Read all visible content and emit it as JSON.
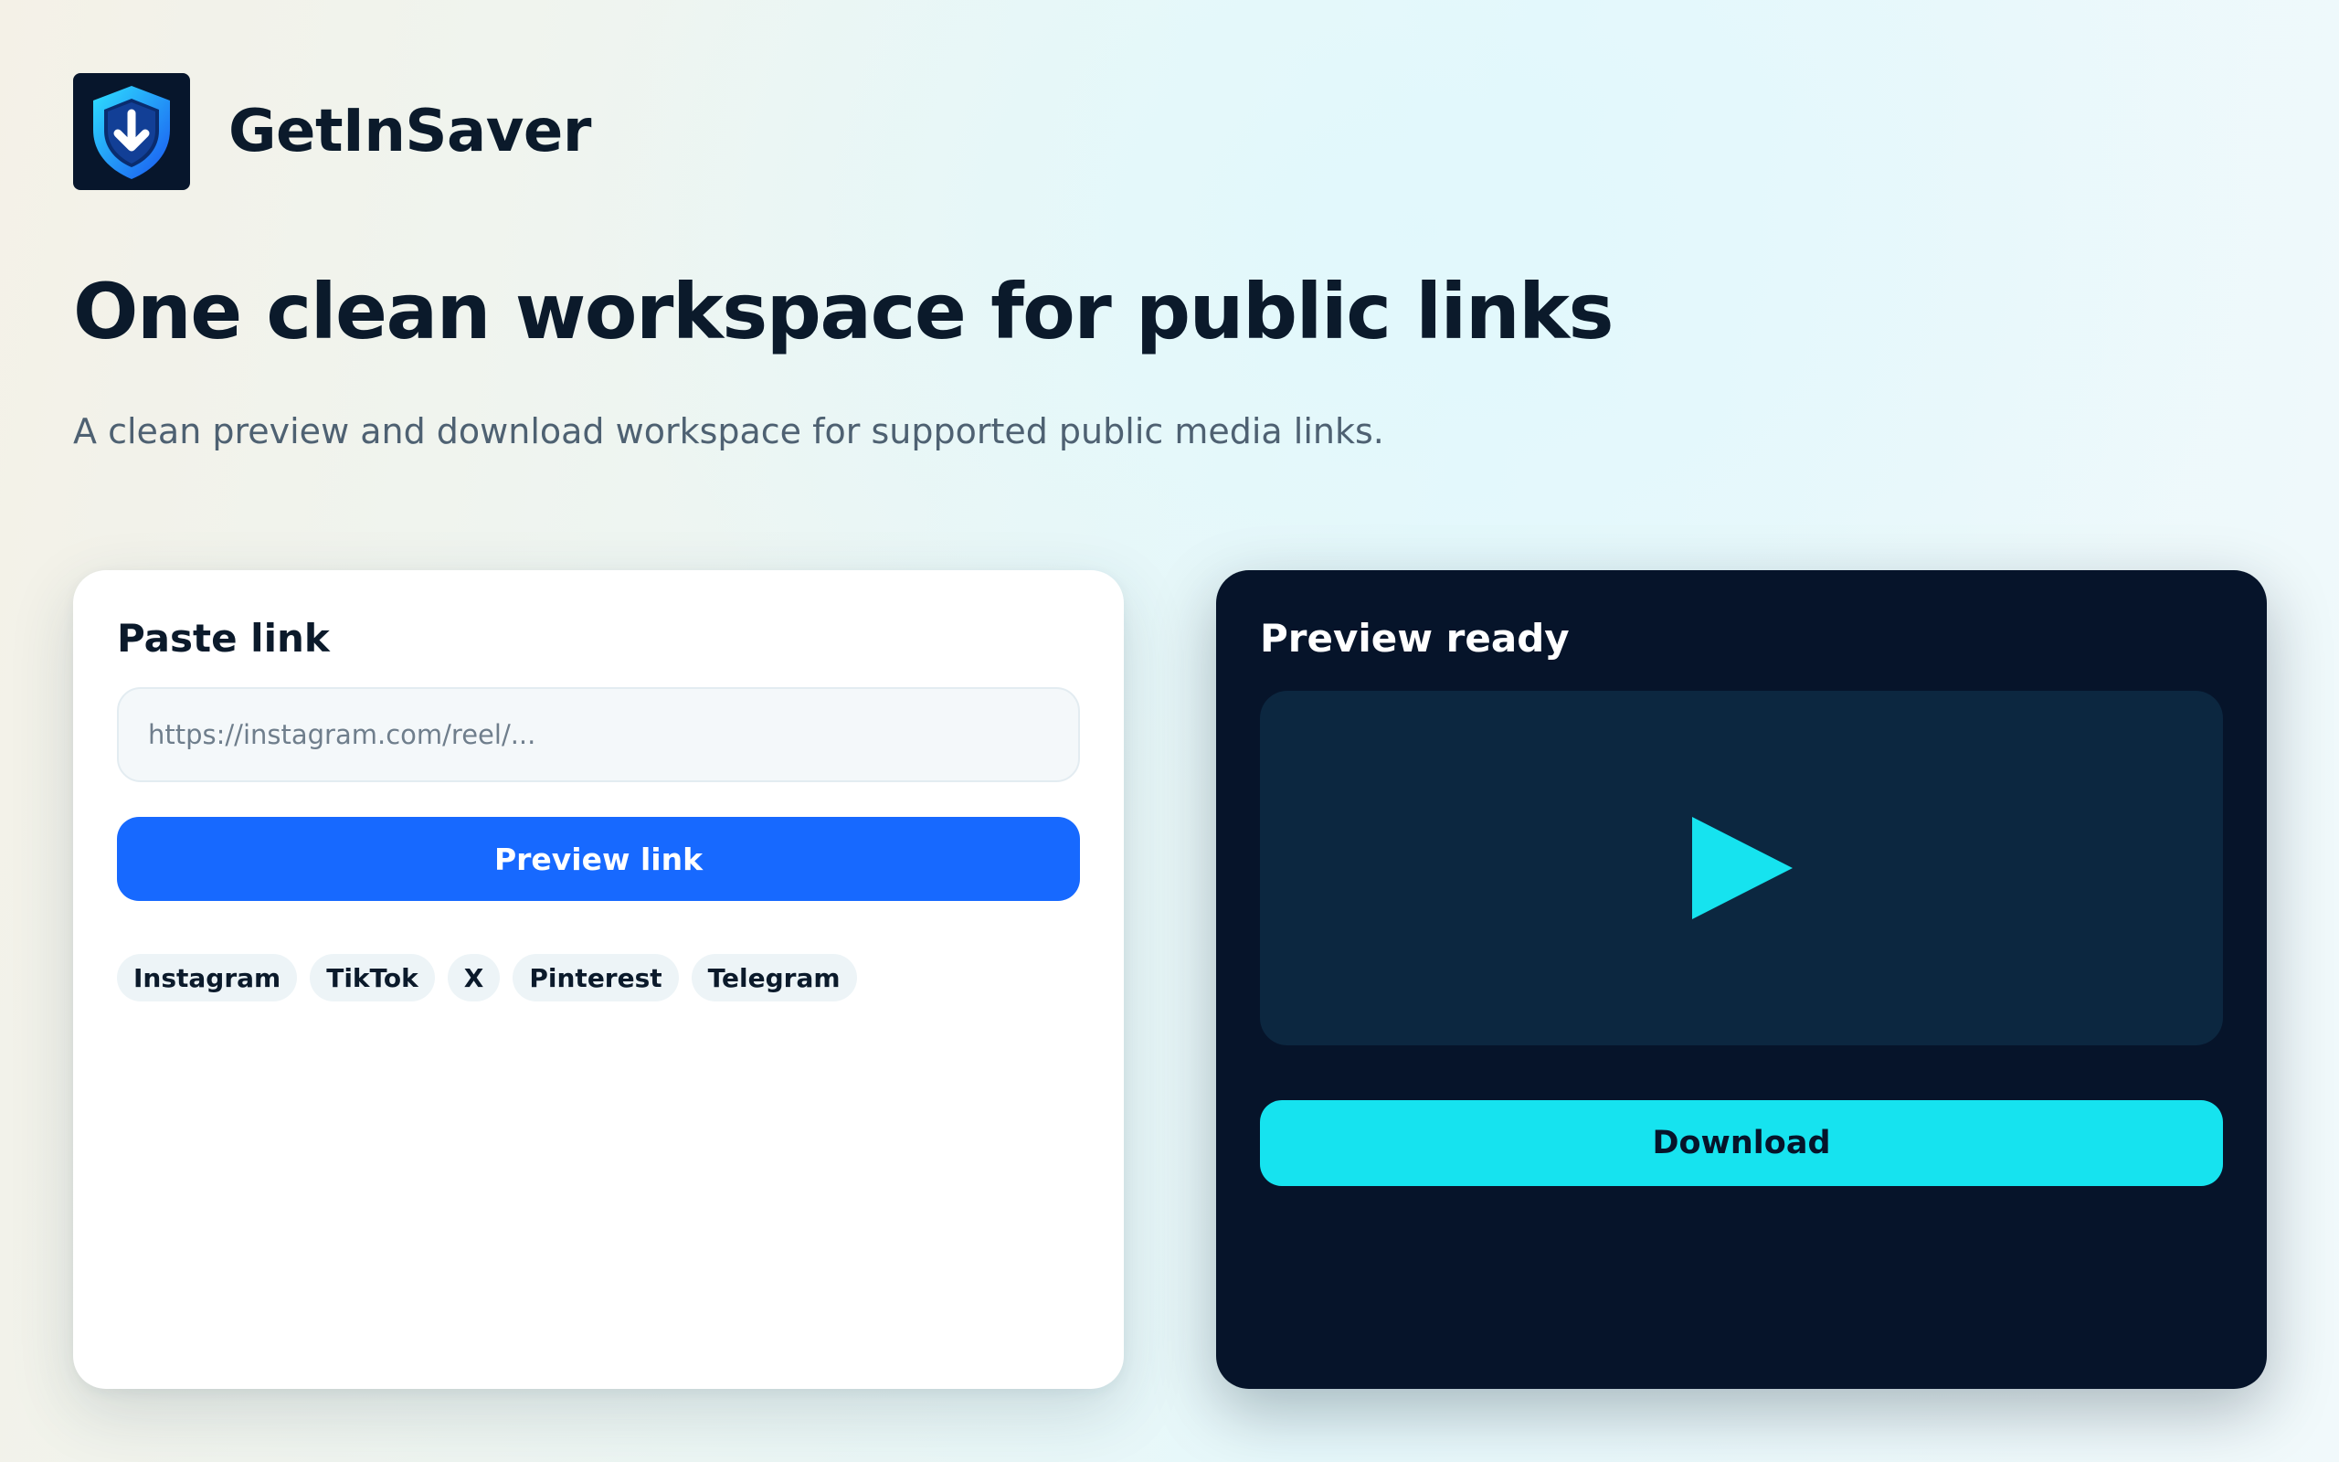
{
  "brand": {
    "name": "GetInSaver",
    "logo_icon": "shield-download-icon"
  },
  "hero": {
    "headline": "One clean workspace for public links",
    "subheadline": "A clean preview and download workspace for supported public media links."
  },
  "paste_panel": {
    "title": "Paste link",
    "input_value": "",
    "input_placeholder": "https://instagram.com/reel/...",
    "preview_button_label": "Preview link",
    "platforms": [
      "Instagram",
      "TikTok",
      "X",
      "Pinterest",
      "Telegram"
    ]
  },
  "preview_panel": {
    "title": "Preview ready",
    "play_icon": "play-icon",
    "download_button_label": "Download"
  },
  "colors": {
    "primary_blue": "#1769ff",
    "accent_cyan": "#16e3ef",
    "dark_panel": "#06142a",
    "preview_surface": "#0c2740",
    "text_dark": "#0b1a2b",
    "text_muted": "#4e6172"
  }
}
